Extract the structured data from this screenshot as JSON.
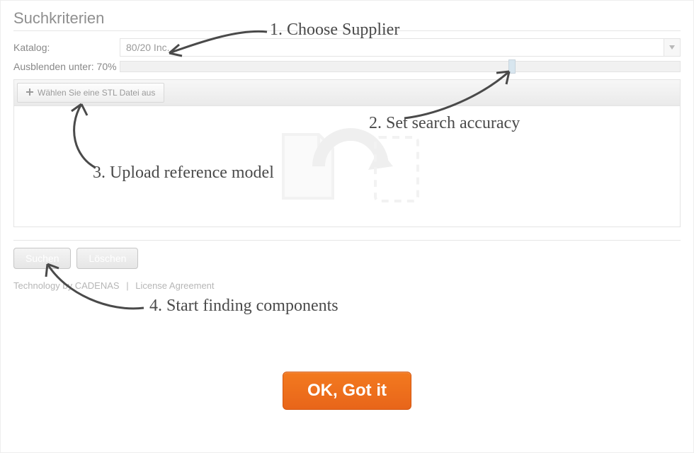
{
  "title": "Suchkriterien",
  "catalog": {
    "label": "Katalog:",
    "selected": "80/20 Inc."
  },
  "threshold": {
    "label": "Ausblenden unter:",
    "value": "70%"
  },
  "upload": {
    "button": "Wählen Sie eine STL Datei aus"
  },
  "actions": {
    "search": "Suchen",
    "clear": "Löschen"
  },
  "footer": {
    "tech": "Technology by CADENAS",
    "license": "License Agreement"
  },
  "cta": {
    "ok": "OK, Got it"
  },
  "annotations": {
    "a1": "1. Choose Supplier",
    "a2": "2. Set search accuracy",
    "a3": "3. Upload reference model",
    "a4": "4. Start finding components"
  }
}
